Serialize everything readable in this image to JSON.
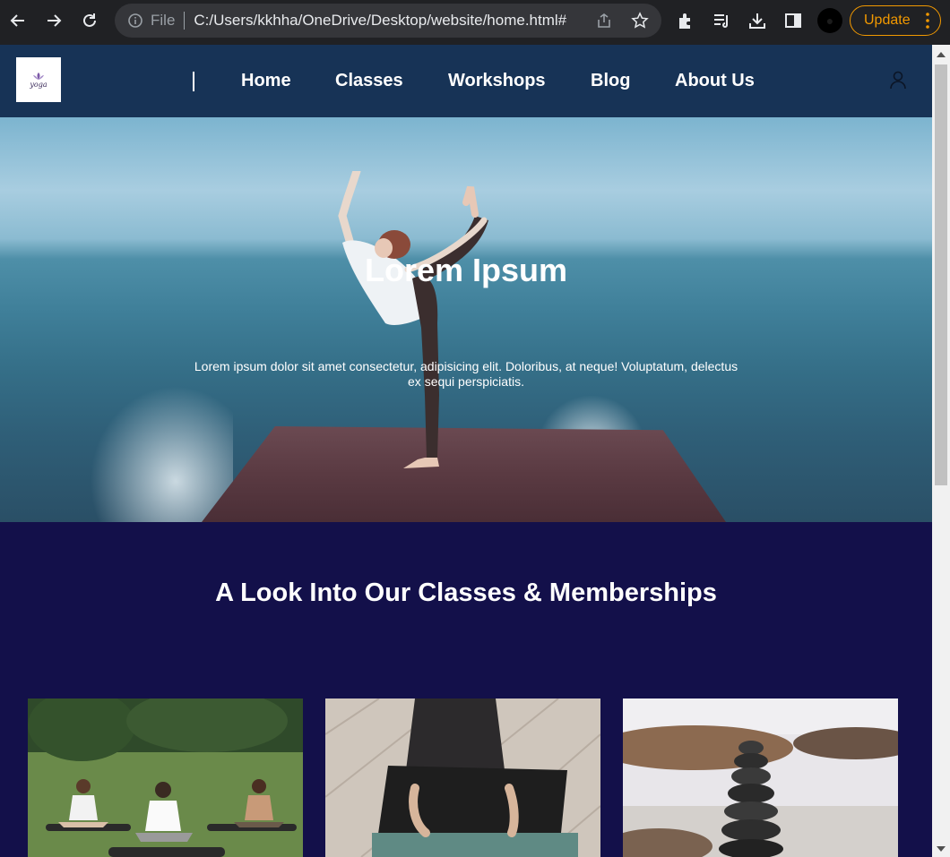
{
  "browser": {
    "file_label": "File",
    "url": "C:/Users/kkhha/OneDrive/Desktop/website/home.html#",
    "update_label": "Update",
    "accent": "#f29900"
  },
  "site": {
    "logo_text": "yoga",
    "nav": {
      "links": [
        "Home",
        "Classes",
        "Workshops",
        "Blog",
        "About Us"
      ],
      "background": "#173356"
    },
    "hero": {
      "title": "Lorem Ipsum",
      "text": "Lorem ipsum dolor sit amet consectetur, adipisicing elit. Doloribus, at neque! Voluptatum, delectus ex sequi perspiciatis."
    },
    "section": {
      "title": "A Look Into Our Classes & Memberships",
      "background": "#13104a"
    },
    "cards": [
      {
        "image": "group-meditation-photo"
      },
      {
        "image": "yoga-mat-photo"
      },
      {
        "image": "stacked-stones-photo"
      }
    ]
  }
}
